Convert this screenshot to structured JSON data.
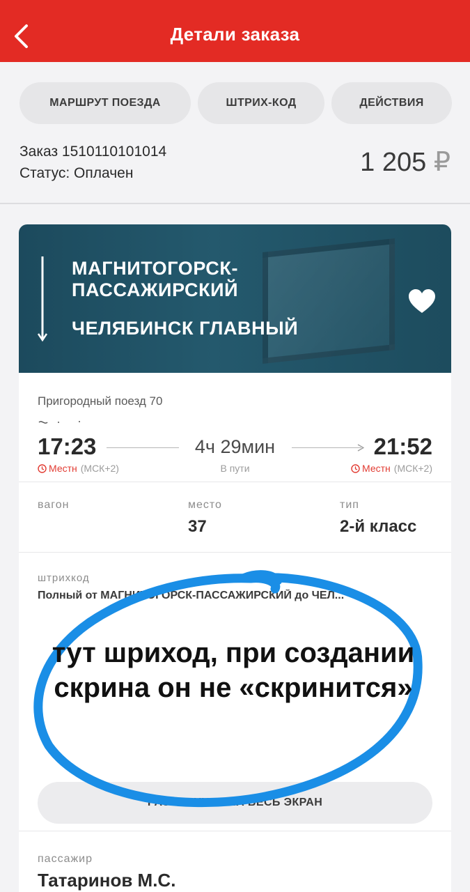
{
  "header": {
    "title": "Детали заказа",
    "back_icon": "chevron-left-icon",
    "background": "#e32b24"
  },
  "tabs": [
    {
      "label": "МАРШРУТ ПОЕЗДА"
    },
    {
      "label": "ШТРИХ-КОД"
    },
    {
      "label": "ДЕЙСТВИЯ"
    }
  ],
  "order": {
    "number_text": "Заказ 1510110101014",
    "status_text": "Статус: Оплачен",
    "price": "1 205",
    "currency": "₽"
  },
  "route": {
    "from": "МАГНИТОГОРСК-ПАССАЖИРСКИЙ",
    "to": "ЧЕЛЯБИНСК ГЛАВНЫЙ",
    "favorite_icon": "heart-icon",
    "header_color": "#1f4f62"
  },
  "trip": {
    "train_type": "Пригородный поезд 70",
    "departure_time": "17:23",
    "arrival_time": "21:52",
    "duration": "4ч 29мин",
    "duration_caption": "В пути",
    "tz_local": "Местн",
    "tz_offset": "(МСК+2)",
    "accent_color": "#e23b32"
  },
  "seat": {
    "wagon_label": "вагон",
    "wagon_value": "",
    "seat_label": "место",
    "seat_value": "37",
    "type_label": "тип",
    "type_value": "2-й класс"
  },
  "barcode": {
    "label": "штрихкод",
    "description": "Полный от МАГНИТОГОРСК-ПАССАЖИРСКИЙ до ЧЕЛ...",
    "expand_label": "РАЗВЕРНУТЬ НА ВЕСЬ ЭКРАН"
  },
  "passenger": {
    "label": "пассажир",
    "name": "Татаринов М.С."
  },
  "annotation": {
    "text": "тут шриход, при создании скрина он не «скринится»",
    "color": "#1a8ee6"
  }
}
